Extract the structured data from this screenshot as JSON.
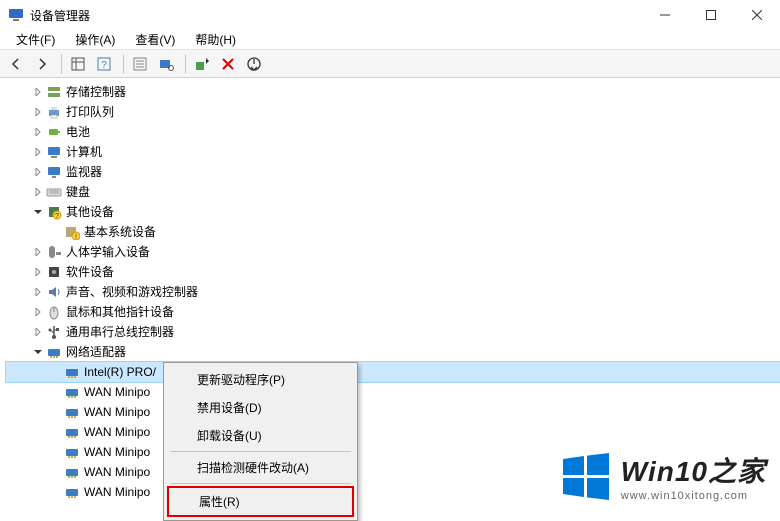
{
  "window": {
    "title": "设备管理器"
  },
  "menu": {
    "file": "文件(F)",
    "action": "操作(A)",
    "view": "查看(V)",
    "help": "帮助(H)"
  },
  "tree": {
    "items": [
      {
        "label": "存储控制器",
        "indent": 1,
        "arrow": "right",
        "icon": "storage"
      },
      {
        "label": "打印队列",
        "indent": 1,
        "arrow": "right",
        "icon": "printer"
      },
      {
        "label": "电池",
        "indent": 1,
        "arrow": "right",
        "icon": "battery"
      },
      {
        "label": "计算机",
        "indent": 1,
        "arrow": "right",
        "icon": "computer"
      },
      {
        "label": "监视器",
        "indent": 1,
        "arrow": "right",
        "icon": "monitor"
      },
      {
        "label": "键盘",
        "indent": 1,
        "arrow": "right",
        "icon": "keyboard"
      },
      {
        "label": "其他设备",
        "indent": 1,
        "arrow": "down",
        "icon": "other"
      },
      {
        "label": "基本系统设备",
        "indent": 2,
        "arrow": "none",
        "icon": "unknown"
      },
      {
        "label": "人体学输入设备",
        "indent": 1,
        "arrow": "right",
        "icon": "hid"
      },
      {
        "label": "软件设备",
        "indent": 1,
        "arrow": "right",
        "icon": "software"
      },
      {
        "label": "声音、视频和游戏控制器",
        "indent": 1,
        "arrow": "right",
        "icon": "sound"
      },
      {
        "label": "鼠标和其他指针设备",
        "indent": 1,
        "arrow": "right",
        "icon": "mouse"
      },
      {
        "label": "通用串行总线控制器",
        "indent": 1,
        "arrow": "right",
        "icon": "usb"
      },
      {
        "label": "网络适配器",
        "indent": 1,
        "arrow": "down",
        "icon": "network"
      },
      {
        "label": "Intel(R) PRO/",
        "indent": 2,
        "arrow": "none",
        "icon": "netadapter",
        "selected": true
      },
      {
        "label": "WAN Minipo",
        "indent": 2,
        "arrow": "none",
        "icon": "netadapter"
      },
      {
        "label": "WAN Minipo",
        "indent": 2,
        "arrow": "none",
        "icon": "netadapter"
      },
      {
        "label": "WAN Minipo",
        "indent": 2,
        "arrow": "none",
        "icon": "netadapter"
      },
      {
        "label": "WAN Minipo",
        "indent": 2,
        "arrow": "none",
        "icon": "netadapter"
      },
      {
        "label": "WAN Minipo",
        "indent": 2,
        "arrow": "none",
        "icon": "netadapter"
      },
      {
        "label": "WAN Minipo",
        "indent": 2,
        "arrow": "none",
        "icon": "netadapter"
      }
    ]
  },
  "context_menu": {
    "items": [
      {
        "label": "更新驱动程序(P)",
        "type": "item"
      },
      {
        "label": "禁用设备(D)",
        "type": "item"
      },
      {
        "label": "卸载设备(U)",
        "type": "item"
      },
      {
        "type": "sep"
      },
      {
        "label": "扫描检测硬件改动(A)",
        "type": "item"
      },
      {
        "type": "sep"
      },
      {
        "label": "属性(R)",
        "type": "item",
        "highlight": true
      }
    ]
  },
  "watermark": {
    "brand": "Win10之家",
    "url": "www.win10xitong.com"
  }
}
